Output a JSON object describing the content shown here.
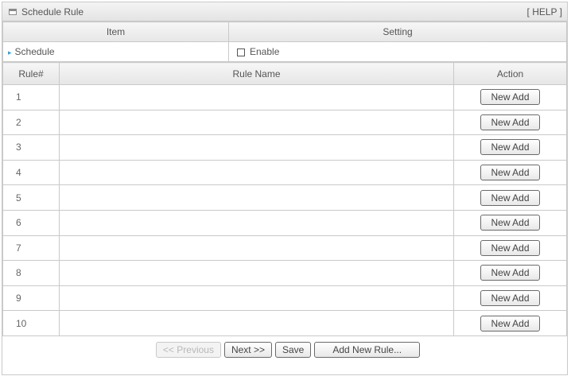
{
  "panel": {
    "title": "Schedule Rule",
    "help_label": "[ HELP ]"
  },
  "settings": {
    "col_item": "Item",
    "col_setting": "Setting",
    "schedule_label": "Schedule",
    "enable_label": "Enable",
    "enable_checked": false
  },
  "rules": {
    "col_num": "Rule#",
    "col_name": "Rule Name",
    "col_action": "Action",
    "rows": [
      {
        "num": "1",
        "name": "",
        "action": "New Add"
      },
      {
        "num": "2",
        "name": "",
        "action": "New Add"
      },
      {
        "num": "3",
        "name": "",
        "action": "New Add"
      },
      {
        "num": "4",
        "name": "",
        "action": "New Add"
      },
      {
        "num": "5",
        "name": "",
        "action": "New Add"
      },
      {
        "num": "6",
        "name": "",
        "action": "New Add"
      },
      {
        "num": "7",
        "name": "",
        "action": "New Add"
      },
      {
        "num": "8",
        "name": "",
        "action": "New Add"
      },
      {
        "num": "9",
        "name": "",
        "action": "New Add"
      },
      {
        "num": "10",
        "name": "",
        "action": "New Add"
      }
    ]
  },
  "footer": {
    "previous_label": "<< Previous",
    "next_label": "Next >>",
    "save_label": "Save",
    "add_rule_label": "Add New Rule..."
  }
}
